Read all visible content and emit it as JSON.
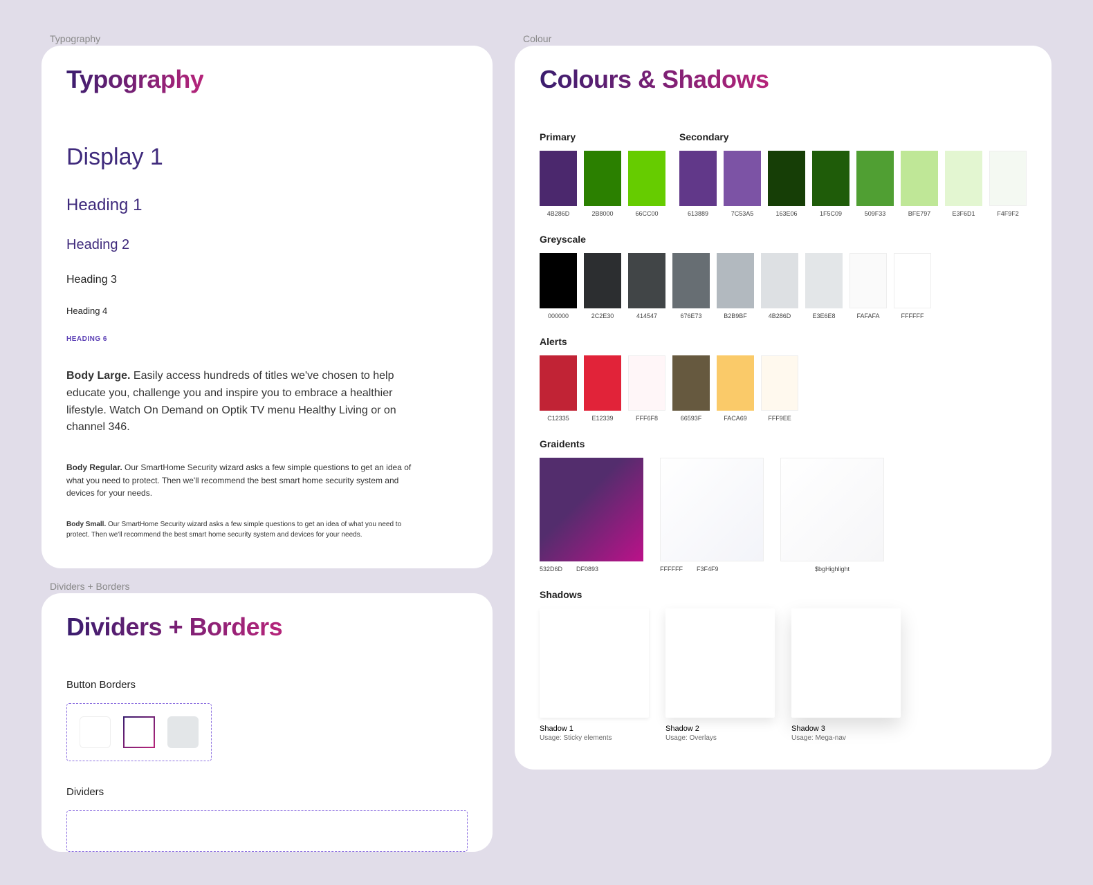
{
  "sections": {
    "typography_label": "Typography",
    "dividers_label": "Dividers + Borders",
    "colour_label": "Colour"
  },
  "typography": {
    "title": "Typography",
    "display1": "Display 1",
    "heading1": "Heading 1",
    "heading2": "Heading 2",
    "heading3": "Heading 3",
    "heading4": "Heading 4",
    "heading6": "HEADING 6",
    "body_large_label": "Body Large.",
    "body_large_text": " Easily access hundreds of titles we've chosen to help educate you, challenge you and inspire you to embrace a healthier lifestyle. Watch On Demand on Optik TV menu Healthy Living or on channel 346.",
    "body_regular_label": "Body Regular.",
    "body_regular_text": " Our SmartHome Security wizard asks a few simple questions to get an idea of what you need to protect. Then we'll recommend the best smart home security system and devices for your needs.",
    "body_small_label": "Body Small.",
    "body_small_text": " Our SmartHome Security wizard asks a few simple questions to get an idea of what you need to protect. Then we'll recommend the best smart home security system and devices for your needs."
  },
  "dividers": {
    "title": "Dividers + Borders",
    "button_borders": "Button Borders",
    "dividers": "Dividers"
  },
  "colours": {
    "title": "Colours & Shadows",
    "primary_label": "Primary",
    "secondary_label": "Secondary",
    "primary": [
      {
        "hex": "4B286D",
        "c": "#4B286D"
      },
      {
        "hex": "2B8000",
        "c": "#2B8000"
      },
      {
        "hex": "66CC00",
        "c": "#66CC00"
      }
    ],
    "secondary": [
      {
        "hex": "613889",
        "c": "#613889"
      },
      {
        "hex": "7C53A5",
        "c": "#7C53A5"
      },
      {
        "hex": "163E06",
        "c": "#163E06"
      },
      {
        "hex": "1F5C09",
        "c": "#1F5C09"
      },
      {
        "hex": "509F33",
        "c": "#509F33"
      },
      {
        "hex": "BFE797",
        "c": "#BFE797"
      },
      {
        "hex": "E3F6D1",
        "c": "#E3F6D1"
      },
      {
        "hex": "F4F9F2",
        "c": "#F4F9F2"
      }
    ],
    "greyscale_label": "Greyscale",
    "greyscale": [
      {
        "hex": "000000",
        "c": "#000000"
      },
      {
        "hex": "2C2E30",
        "c": "#2C2E30"
      },
      {
        "hex": "414547",
        "c": "#414547"
      },
      {
        "hex": "676E73",
        "c": "#676E73"
      },
      {
        "hex": "B2B9BF",
        "c": "#B2B9BF"
      },
      {
        "hex": "4B286D",
        "c": "#DDE0E3"
      },
      {
        "hex": "E3E6E8",
        "c": "#E3E6E8"
      },
      {
        "hex": "FAFAFA",
        "c": "#FAFAFA"
      },
      {
        "hex": "FFFFFF",
        "c": "#FFFFFF"
      }
    ],
    "alerts_label": "Alerts",
    "alerts": [
      {
        "hex": "C12335",
        "c": "#C12335"
      },
      {
        "hex": "E12339",
        "c": "#E12339"
      },
      {
        "hex": "FFF6F8",
        "c": "#FFF6F8"
      },
      {
        "hex": "66593F",
        "c": "#66593F"
      },
      {
        "hex": "FACA69",
        "c": "#FACA69"
      },
      {
        "hex": "FFF9EE",
        "c": "#FFF9EE"
      }
    ],
    "gradients_label": "Graidents",
    "gradients": [
      {
        "type": "purple",
        "labels": [
          "532D6D",
          "DF0893"
        ]
      },
      {
        "type": "neutral",
        "labels": [
          "FFFFFF",
          "F3F4F9"
        ]
      },
      {
        "type": "highlight",
        "labels": [
          "$bgHighlight"
        ]
      }
    ],
    "shadows_label": "Shadows",
    "shadows": [
      {
        "name": "Shadow 1",
        "usage": "Usage: Sticky elements"
      },
      {
        "name": "Shadow 2",
        "usage": "Usage: Overlays"
      },
      {
        "name": "Shadow 3",
        "usage": "Usage: Mega-nav"
      }
    ]
  }
}
